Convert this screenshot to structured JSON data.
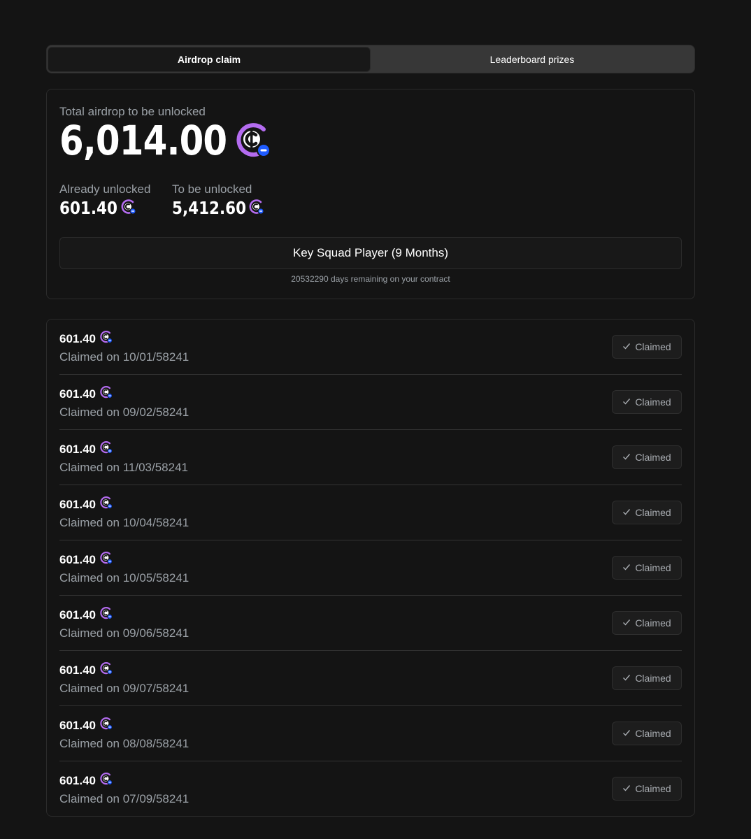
{
  "tabs": {
    "airdrop_claim": "Airdrop claim",
    "leaderboard_prizes": "Leaderboard prizes"
  },
  "summary": {
    "total_label": "Total airdrop to be unlocked",
    "total_value": "6,014.00",
    "already_unlocked_label": "Already unlocked",
    "already_unlocked_value": "601.40",
    "to_be_unlocked_label": "To be unlocked",
    "to_be_unlocked_value": "5,412.60",
    "player_tier": "Key Squad Player (9 Months)",
    "remaining_text": "20532290 days remaining on your contract"
  },
  "claims": [
    {
      "amount": "601.40",
      "date": "Claimed on 10/01/58241",
      "status": "Claimed"
    },
    {
      "amount": "601.40",
      "date": "Claimed on 09/02/58241",
      "status": "Claimed"
    },
    {
      "amount": "601.40",
      "date": "Claimed on 11/03/58241",
      "status": "Claimed"
    },
    {
      "amount": "601.40",
      "date": "Claimed on 10/04/58241",
      "status": "Claimed"
    },
    {
      "amount": "601.40",
      "date": "Claimed on 10/05/58241",
      "status": "Claimed"
    },
    {
      "amount": "601.40",
      "date": "Claimed on 09/06/58241",
      "status": "Claimed"
    },
    {
      "amount": "601.40",
      "date": "Claimed on 09/07/58241",
      "status": "Claimed"
    },
    {
      "amount": "601.40",
      "date": "Claimed on 08/08/58241",
      "status": "Claimed"
    },
    {
      "amount": "601.40",
      "date": "Claimed on 07/09/58241",
      "status": "Claimed"
    }
  ],
  "icons": {
    "token": "token-coin-icon",
    "check": "check-icon"
  },
  "colors": {
    "background": "#141414",
    "token_purple": "#b46cf0",
    "token_badge_blue": "#1e5bff",
    "muted_text": "#9aa0a6"
  }
}
